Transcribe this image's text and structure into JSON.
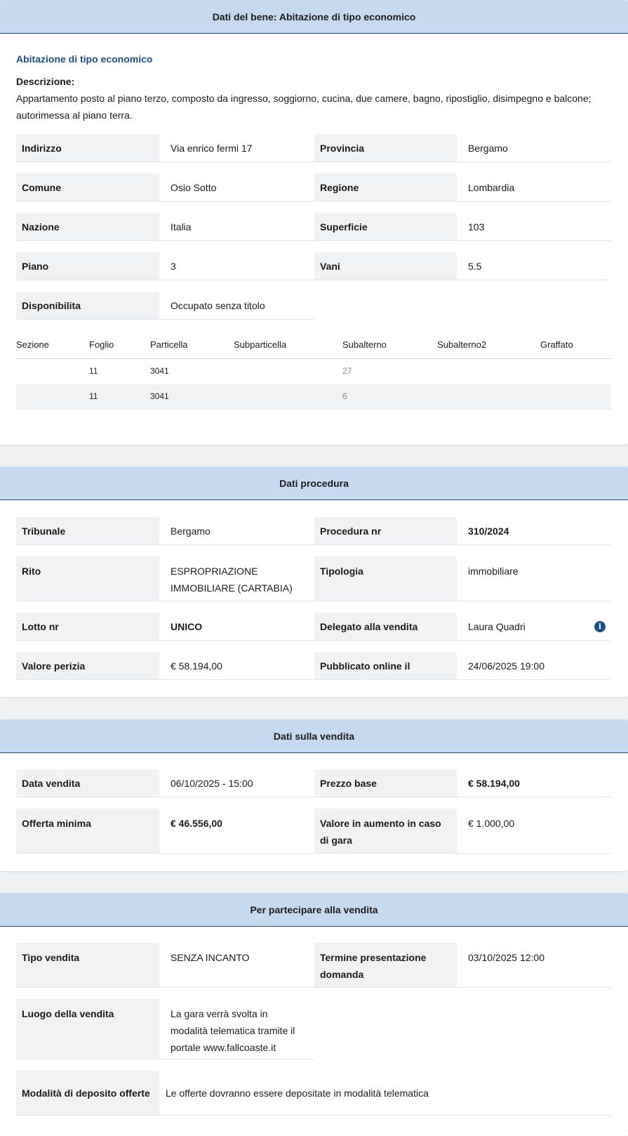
{
  "bene": {
    "header": "Dati del bene: Abitazione di tipo economico",
    "subtitle": "Abitazione di tipo economico",
    "desc_label": "Descrizione:",
    "desc_text": "Appartamento posto al piano terzo, composto da ingresso, soggiorno, cucina, due camere, bagno, ripostiglio, disimpegno e balcone; autorimessa al piano terra.",
    "fields": {
      "indirizzo": {
        "label": "Indirizzo",
        "value": "Via enrico fermi 17"
      },
      "provincia": {
        "label": "Provincia",
        "value": "Bergamo"
      },
      "comune": {
        "label": "Comune",
        "value": "Osio Sotto"
      },
      "regione": {
        "label": "Regione",
        "value": "Lombardia"
      },
      "nazione": {
        "label": "Nazione",
        "value": "Italia"
      },
      "superficie": {
        "label": "Superficie",
        "value": "103"
      },
      "piano": {
        "label": "Piano",
        "value": "3"
      },
      "vani": {
        "label": "Vani",
        "value": "5.5"
      },
      "disponibilita": {
        "label": "Disponibilita",
        "value": "Occupato senza titolo"
      }
    },
    "catasto": {
      "headers": [
        "Sezione",
        "Foglio",
        "Particella",
        "Subparticella",
        "Subalterno",
        "Subalterno2",
        "Graffato"
      ],
      "rows": [
        [
          "",
          "11",
          "3041",
          "",
          "27",
          "",
          ""
        ],
        [
          "",
          "11",
          "3041",
          "",
          "6",
          "",
          ""
        ]
      ]
    }
  },
  "procedura": {
    "header": "Dati procedura",
    "fields": {
      "tribunale": {
        "label": "Tribunale",
        "value": "Bergamo"
      },
      "procedura_nr": {
        "label": "Procedura nr",
        "value": "310/2024"
      },
      "rito": {
        "label": "Rito",
        "value": "ESPROPRIAZIONE IMMOBILIARE (CARTABIA)"
      },
      "tipologia": {
        "label": "Tipologia",
        "value": "immobiliare"
      },
      "lotto_nr": {
        "label": "Lotto nr",
        "value": "UNICO"
      },
      "delegato": {
        "label": "Delegato alla vendita",
        "value": "Laura Quadri"
      },
      "valore_perizia": {
        "label": "Valore perizia",
        "value": "€ 58.194,00"
      },
      "pubblicato": {
        "label": "Pubblicato online il",
        "value": "24/06/2025 19:00"
      }
    }
  },
  "vendita": {
    "header": "Dati sulla vendita",
    "fields": {
      "data_vendita": {
        "label": "Data vendita",
        "value": "06/10/2025 - 15:00"
      },
      "prezzo_base": {
        "label": "Prezzo base",
        "value": "€ 58.194,00"
      },
      "offerta_minima": {
        "label": "Offerta minima",
        "value": "€ 46.556,00"
      },
      "aumento": {
        "label": "Valore in aumento in caso di gara",
        "value": "€ 1.000,00"
      }
    }
  },
  "partecipare": {
    "header": "Per partecipare alla vendita",
    "fields": {
      "tipo_vendita": {
        "label": "Tipo vendita",
        "value": "SENZA INCANTO"
      },
      "termine": {
        "label": "Termine presentazione domanda",
        "value": "03/10/2025 12:00"
      },
      "luogo": {
        "label": "Luogo della vendita",
        "value": "La gara verrà svolta in modalità telematica tramite il portale www.fallcoaste.it"
      },
      "deposito": {
        "label": "Modalità di deposito offerte",
        "value": "Le offerte dovranno essere depositate in modalità telematica"
      }
    }
  },
  "icons": {
    "info": "info-icon"
  },
  "colors": {
    "header_bg": "#c6d9ee",
    "header_border": "#1f4f86",
    "accent": "#1f4f86",
    "label_bg": "#f1f2f4"
  }
}
